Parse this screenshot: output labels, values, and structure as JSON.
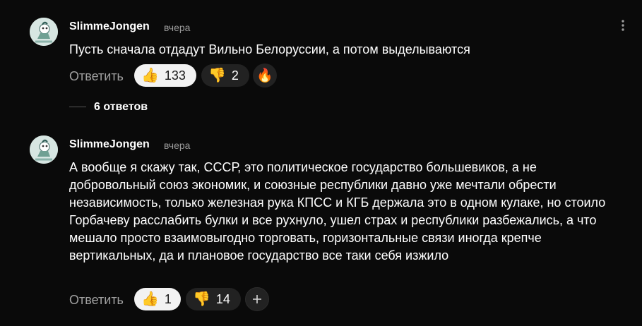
{
  "comments": [
    {
      "username": "SlimmeJongen",
      "time": "вчера",
      "text": "Пусть сначала отдадут Вильно Белоруссии, а потом выделываются",
      "reply_label": "Ответить",
      "likes": "133",
      "dislikes": "2",
      "replies_label": "6 ответов"
    },
    {
      "username": "SlimmeJongen",
      "time": "вчера",
      "text": "А вообще я скажу так, СССР, это политическое государство большевиков, а не добровольный союз экономик, и союзные республики давно уже мечтали обрести независимость, только железная рука КПСС и КГБ держала это в одном кулаке, но стоило Горбачеву расслабить булки и все рухнуло, ушел страх и республики разбежались, а что мешало просто взаимовыгодно торговать, горизонтальные связи иногда крепче вертикальных, да и плановое государство все таки себя изжило",
      "reply_label": "Ответить",
      "likes": "1",
      "dislikes": "14"
    }
  ],
  "icons": {
    "like": "thumbs-up-emoji",
    "dislike": "thumbs-down-emoji",
    "fire_reaction": "fire-reaction-icon",
    "add_reaction": "plus-icon",
    "more": "more-vertical-icon"
  },
  "colors": {
    "background": "#0a0a0a",
    "active_pill": "#f2f2f2",
    "dark_pill": "#222222",
    "muted_text": "#9b9b9b"
  }
}
